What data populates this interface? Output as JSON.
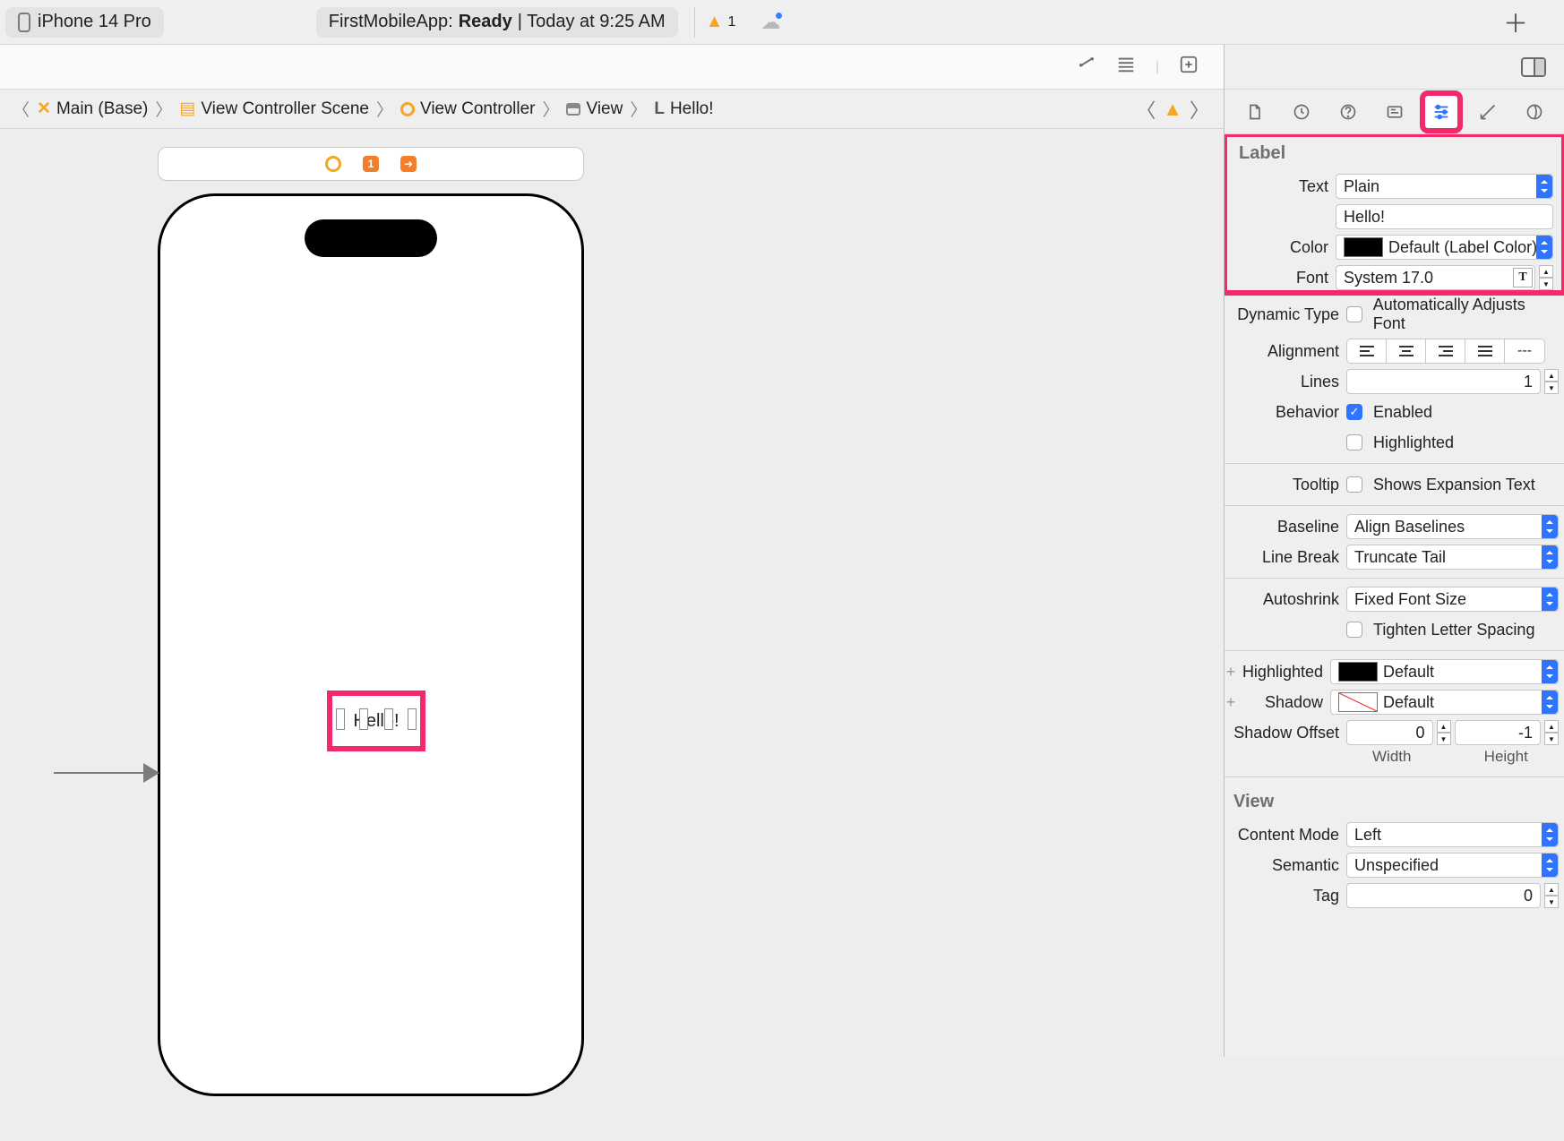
{
  "topbar": {
    "device": "iPhone 14 Pro",
    "project": "FirstMobileApp:",
    "status": "Ready",
    "status_suffix": "| Today at 9:25 AM",
    "warning_count": "1"
  },
  "breadcrumbs": {
    "b1": "Main (Base)",
    "b2": "View Controller Scene",
    "b3": "View Controller",
    "b4": "View",
    "b5_prefix": "L",
    "b5": "Hello!"
  },
  "canvas": {
    "label_text": "Hello!"
  },
  "inspector": {
    "section_label": "Label",
    "text_label": "Text",
    "text_mode": "Plain",
    "text_value": "Hello!",
    "color_label": "Color",
    "color_value": "Default (Label Color)",
    "font_label": "Font",
    "font_value": "System 17.0",
    "dynamic_type_label": "Dynamic Type",
    "dynamic_type_opt": "Automatically Adjusts Font",
    "alignment_label": "Alignment",
    "lines_label": "Lines",
    "lines_value": "1",
    "behavior_label": "Behavior",
    "behavior_enabled": "Enabled",
    "behavior_highlighted": "Highlighted",
    "tooltip_label": "Tooltip",
    "tooltip_opt": "Shows Expansion Text",
    "baseline_label": "Baseline",
    "baseline_value": "Align Baselines",
    "linebreak_label": "Line Break",
    "linebreak_value": "Truncate Tail",
    "autoshrink_label": "Autoshrink",
    "autoshrink_value": "Fixed Font Size",
    "tighten_label": "Tighten Letter Spacing",
    "highlighted_label": "Highlighted",
    "highlighted_value": "Default",
    "shadow_label": "Shadow",
    "shadow_value": "Default",
    "shadow_offset_label": "Shadow Offset",
    "shadow_offset_w": "0",
    "shadow_offset_h": "-1",
    "shadow_offset_w_label": "Width",
    "shadow_offset_h_label": "Height",
    "section_view": "View",
    "content_mode_label": "Content Mode",
    "content_mode_value": "Left",
    "semantic_label": "Semantic",
    "semantic_value": "Unspecified",
    "tag_label": "Tag",
    "tag_value": "0",
    "alignment_extra": "---"
  }
}
